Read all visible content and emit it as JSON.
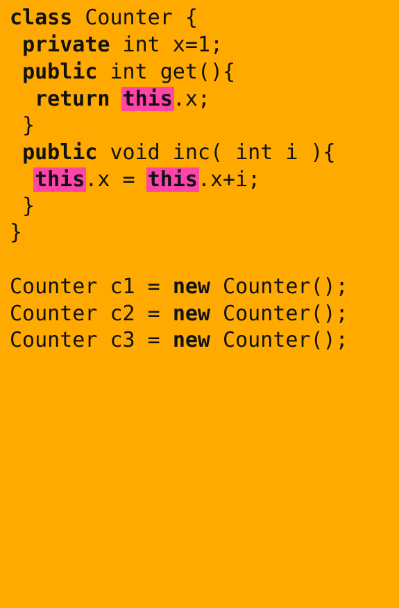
{
  "colors": {
    "background": "#FFAA00",
    "highlight": "#FF44AA",
    "text": "#111111"
  },
  "code": {
    "l1": {
      "kw": "class",
      "rest": " Counter {"
    },
    "l2": {
      "indent": " ",
      "kw": "private",
      "rest": " int x=1;"
    },
    "l3": {
      "indent": " ",
      "kw": "public",
      "rest": " int get(){"
    },
    "l4": {
      "indent": "  ",
      "kw": "return",
      "sp": " ",
      "this": "this",
      "rest": ".x;"
    },
    "l5": {
      "text": " }"
    },
    "l6": {
      "indent": " ",
      "kw": "public",
      "rest": " void inc( int i ){"
    },
    "l7": {
      "indent": "  ",
      "this1": "this",
      "mid": ".x = ",
      "this2": "this",
      "rest": ".x+i;"
    },
    "l8": {
      "text": " }"
    },
    "l9": {
      "text": "}"
    },
    "l11": {
      "pre": "Counter c1 = ",
      "kw": "new",
      "rest": " Counter();"
    },
    "l12": {
      "pre": "Counter c2 = ",
      "kw": "new",
      "rest": " Counter();"
    },
    "l13": {
      "pre": "Counter c3 = ",
      "kw": "new",
      "rest": " Counter();"
    }
  }
}
